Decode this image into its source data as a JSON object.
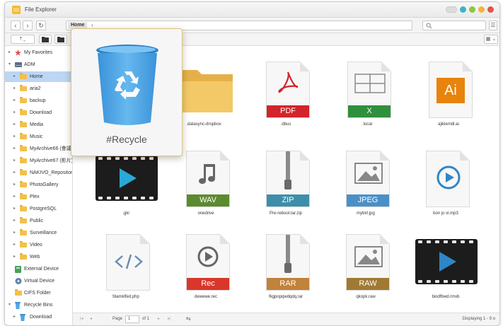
{
  "window": {
    "title": "File Explorer"
  },
  "address": {
    "path": "Home",
    "search_placeholder": ""
  },
  "sidebar": [
    {
      "label": "My Favorites",
      "icon": "star-icon"
    },
    {
      "label": "ADM",
      "icon": "drive-icon"
    },
    {
      "label": "Home",
      "icon": "folder-icon",
      "selected": true
    },
    {
      "label": "aria2",
      "icon": "folder-icon"
    },
    {
      "label": "backup",
      "icon": "folder-icon"
    },
    {
      "label": "Download",
      "icon": "folder-icon"
    },
    {
      "label": "Media",
      "icon": "folder-icon"
    },
    {
      "label": "Music",
      "icon": "folder-icon"
    },
    {
      "label": "MyArchive66 (會議)",
      "icon": "folder-icon"
    },
    {
      "label": "MyArchive67 (影片)",
      "icon": "folder-icon"
    },
    {
      "label": "NAKIVO_Repository",
      "icon": "folder-icon"
    },
    {
      "label": "PhotoGallery",
      "icon": "folder-icon"
    },
    {
      "label": "Plex",
      "icon": "folder-icon"
    },
    {
      "label": "PostgreSQL",
      "icon": "folder-icon"
    },
    {
      "label": "Public",
      "icon": "folder-icon"
    },
    {
      "label": "Surveillance",
      "icon": "folder-icon"
    },
    {
      "label": "Video",
      "icon": "folder-icon"
    },
    {
      "label": "Web",
      "icon": "folder-icon"
    },
    {
      "label": "External Device",
      "icon": "external-device-icon"
    },
    {
      "label": "Virtual Device",
      "icon": "virtual-device-icon"
    },
    {
      "label": "CIFS Folder",
      "icon": "cifs-folder-icon"
    },
    {
      "label": "Recycle Bins",
      "icon": "recycle-bin-icon"
    },
    {
      "label": "Download",
      "icon": "recycle-bin-icon"
    }
  ],
  "files": [
    {
      "name": ".datasync-dropbox",
      "kind": "folder"
    },
    {
      "name": ".dbus",
      "kind": "PDF",
      "color": "#d3242b"
    },
    {
      "name": ".local",
      "kind": "X",
      "color": "#2f8f3c"
    },
    {
      "name": "ajiklemdl.ai",
      "kind": "Ai",
      "color": "#e8830c"
    },
    {
      "name": ".gki",
      "kind": "video"
    },
    {
      "name": "onedrive",
      "kind": "WAV",
      "color": "#5b8a2f"
    },
    {
      "name": "Pre-reboot.tar.zip",
      "kind": "ZIP",
      "color": "#3e8ea9"
    },
    {
      "name": "mybirl.jpg",
      "kind": "JPEG",
      "color": "#4a90c8"
    },
    {
      "name": "bon jo vi.mp3",
      "kind": "audio"
    },
    {
      "name": "fdamklfed.php",
      "kind": "code"
    },
    {
      "name": "dewewe.rec",
      "kind": "Rec",
      "color": "#d9372b"
    },
    {
      "name": "fkgpopqwdqdq.rar",
      "kind": "RAR",
      "color": "#c1823a"
    },
    {
      "name": "qkopk.raw",
      "kind": "RAW",
      "color": "#a07a34"
    },
    {
      "name": "biodfbwd.rmvb",
      "kind": "video"
    }
  ],
  "status": {
    "page_label": "Page",
    "page_value": "1",
    "of_label": "of 1",
    "displaying": "Displaying 1 - 9 o"
  },
  "popup": {
    "label": "#Recycle"
  },
  "colors": {
    "accent": "#4a90c8",
    "selected": "#bcd6f3"
  }
}
